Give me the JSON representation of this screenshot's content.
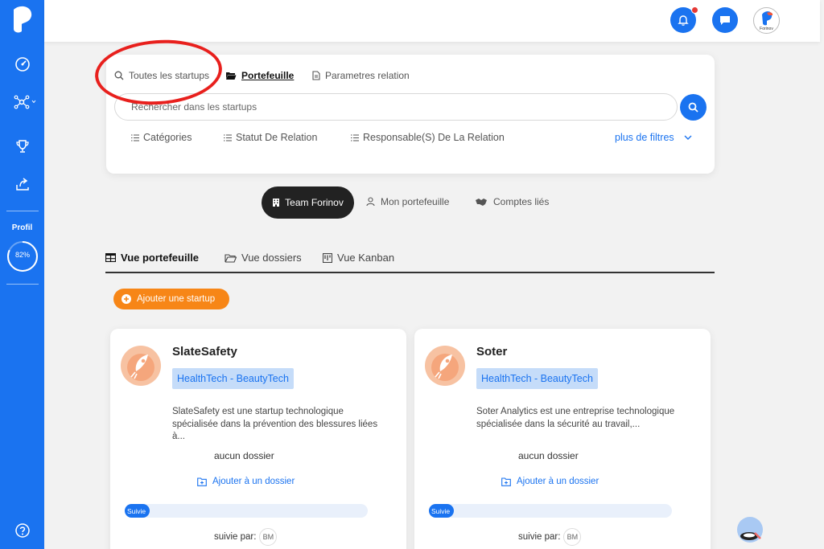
{
  "topbar": {
    "avatar_text": "Forinov"
  },
  "sidebar": {
    "profile_label": "Profil",
    "profile_progress_text": "82%",
    "profile_progress": 0.82
  },
  "search": {
    "tabs": [
      {
        "label": "Toutes les startups",
        "icon": "search-icon"
      },
      {
        "label": "Portefeuille",
        "icon": "folder-open-icon"
      },
      {
        "label": "Parametres relation",
        "icon": "document-icon"
      }
    ],
    "placeholder": "Rechercher dans les startups",
    "filters": [
      {
        "label": "Catégories",
        "icon": "list-icon"
      },
      {
        "label": "Statut De Relation",
        "icon": "list-icon"
      },
      {
        "label": "Responsable(S) De La Relation",
        "icon": "list-icon"
      }
    ],
    "more_filters": "plus de filtres"
  },
  "segments": [
    {
      "label": "Team Forinov",
      "icon": "building-icon"
    },
    {
      "label": "Mon portefeuille",
      "icon": "user-icon"
    },
    {
      "label": "Comptes liés",
      "icon": "handshake-icon"
    }
  ],
  "views": [
    {
      "label": "Vue portefeuille",
      "icon": "table-icon"
    },
    {
      "label": "Vue dossiers",
      "icon": "folder-icon"
    },
    {
      "label": "Vue Kanban",
      "icon": "kanban-icon"
    }
  ],
  "add_startup_label": "Ajouter une startup",
  "cards": [
    {
      "name": "SlateSafety",
      "tag": "HealthTech - BeautyTech",
      "description": "SlateSafety est une startup technologique spécialisée dans la prévention des blessures liées à...",
      "no_folder": "aucun dossier",
      "add_folder": "Ajouter à un dossier",
      "status_label": "Suivie",
      "status_progress": 0.06,
      "followed_by_label": "suivie par:",
      "followed_by_initials": "BM"
    },
    {
      "name": "Soter",
      "tag": "HealthTech - BeautyTech",
      "description": "Soter Analytics est une entreprise technologique spécialisée dans la sécurité au travail,...",
      "no_folder": "aucun dossier",
      "add_folder": "Ajouter à un dossier",
      "status_label": "Suivie",
      "status_progress": 0.06,
      "followed_by_label": "suivie par:",
      "followed_by_initials": "BM"
    }
  ],
  "colors": {
    "brand_blue": "#1a73f0",
    "accent_orange": "#f78617",
    "annotation_red": "#e8201d",
    "tag_bg": "#c5dcf9"
  }
}
